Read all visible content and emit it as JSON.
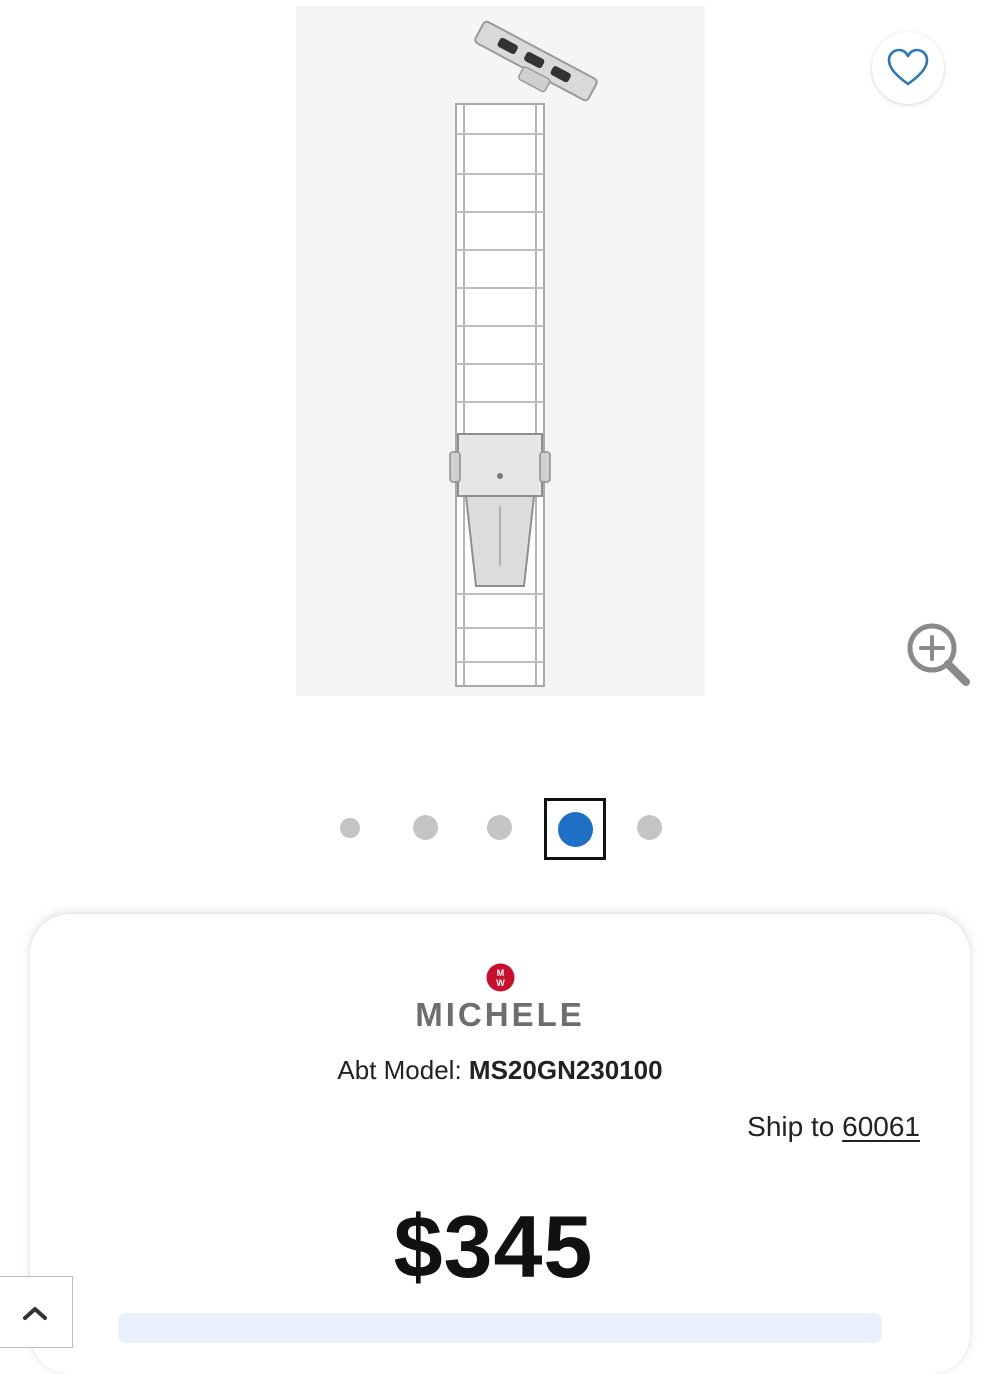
{
  "product": {
    "image_alt": "Apple watch band, silver link bracelet",
    "favorite_icon": "heart-outline-icon",
    "zoom_icon": "zoom-in-icon"
  },
  "carousel": {
    "total": 5,
    "active_index": 4,
    "active_color": "#1f6fc7",
    "inactive_color": "#c4c4c4"
  },
  "brand": {
    "logo_text": "MW",
    "logo_color": "#c8102e",
    "name": "MICHELE"
  },
  "model": {
    "label": "Abt Model:",
    "value": "MS20GN230100"
  },
  "shipping": {
    "label": "Ship to",
    "zip": "60061"
  },
  "price": {
    "amount": "$345"
  },
  "nav": {
    "back_to_top_icon": "chevron-up-icon"
  }
}
